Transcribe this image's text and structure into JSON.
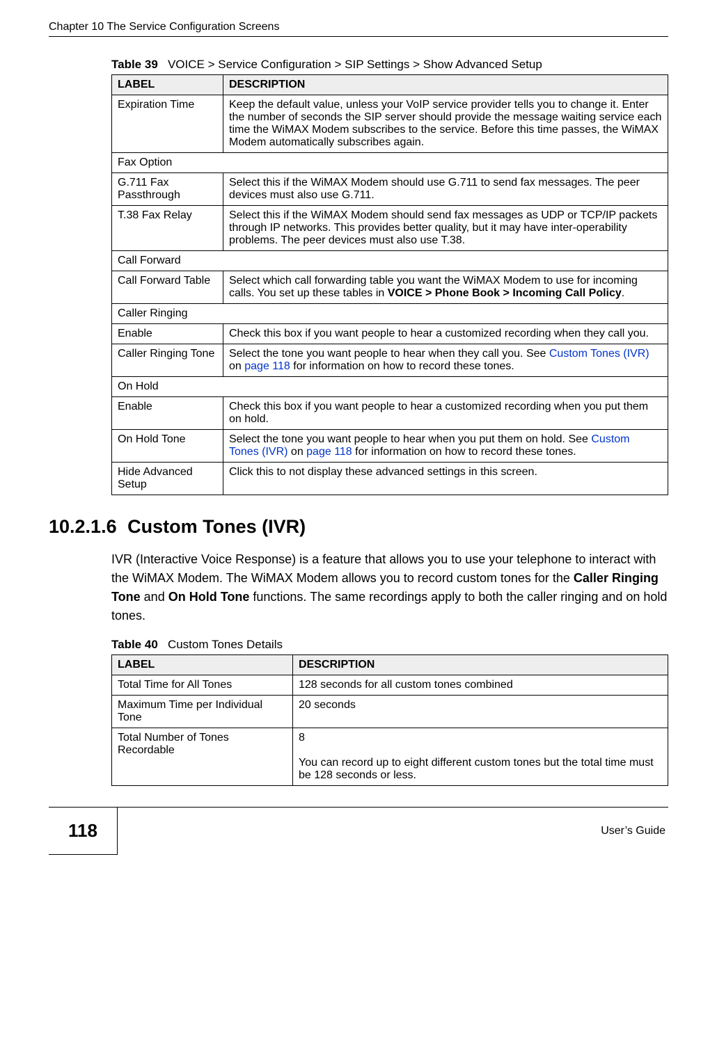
{
  "running_header": "Chapter 10 The Service Configuration Screens",
  "table39": {
    "caption_label": "Table 39",
    "caption_text": "VOICE > Service Configuration > SIP Settings > Show Advanced Setup",
    "headers": {
      "label": "LABEL",
      "description": "DESCRIPTION"
    },
    "rows": {
      "expiration_time": {
        "label": "Expiration Time",
        "desc": "Keep the default value, unless your VoIP service provider tells you to change it. Enter the number of seconds the SIP server should provide the message waiting service each time the WiMAX Modem subscribes to the service. Before this time passes, the WiMAX Modem automatically subscribes again."
      },
      "fax_option": {
        "label": "Fax Option"
      },
      "g711": {
        "label": "G.711 Fax Passthrough",
        "desc": "Select this if the WiMAX Modem should use G.711 to send fax messages. The peer devices must also use G.711."
      },
      "t38": {
        "label": "T.38 Fax Relay",
        "desc": "Select this if the WiMAX Modem should send fax messages as UDP or TCP/IP packets through IP networks. This provides better quality, but it may have inter-operability problems. The peer devices must also use T.38."
      },
      "call_forward": {
        "label": "Call Forward"
      },
      "call_forward_table": {
        "label": "Call Forward Table",
        "desc_pre": "Select which call forwarding table you want the WiMAX Modem to use for incoming calls. You set up these tables in ",
        "desc_bold": "VOICE > Phone Book > Incoming Call Policy",
        "desc_post": "."
      },
      "caller_ringing": {
        "label": "Caller Ringing"
      },
      "enable1": {
        "label": "Enable",
        "desc": "Check this box if you want people to hear a customized recording when they call you."
      },
      "caller_ringing_tone": {
        "label": "Caller Ringing Tone",
        "desc_pre": "Select the tone you want people to hear when they call you. See ",
        "link": "Custom Tones (IVR)",
        "desc_mid": " on ",
        "link2": "page 118",
        "desc_post": " for information on how to record these tones."
      },
      "on_hold": {
        "label": "On Hold"
      },
      "enable2": {
        "label": "Enable",
        "desc": "Check this box if you want people to hear a customized recording when you put them on hold."
      },
      "on_hold_tone": {
        "label": "On Hold Tone",
        "desc_pre": "Select the tone you want people to hear when you put them on hold. See ",
        "link": "Custom Tones (IVR)",
        "desc_mid": " on ",
        "link2": "page 118",
        "desc_post": " for information on how to record these tones."
      },
      "hide_advanced": {
        "label": "Hide Advanced Setup",
        "desc": "Click this to not display these advanced settings in this screen."
      }
    }
  },
  "section": {
    "number": "10.2.1.6",
    "title": "Custom Tones (IVR)",
    "para_pre": "IVR (Interactive Voice Response) is a feature that allows you to use your telephone to interact with the WiMAX Modem. The WiMAX Modem allows you to record custom tones for the ",
    "bold1": "Caller Ringing Tone",
    "para_mid": " and ",
    "bold2": "On Hold Tone",
    "para_post": " functions. The same recordings apply to both the caller ringing and on hold tones."
  },
  "table40": {
    "caption_label": "Table 40",
    "caption_text": "Custom Tones Details",
    "headers": {
      "label": "LABEL",
      "description": "DESCRIPTION"
    },
    "rows": {
      "total_time": {
        "label": "Total Time for All Tones",
        "desc": "128 seconds for all custom tones combined"
      },
      "max_time": {
        "label": "Maximum Time per Individual Tone",
        "desc": "20 seconds"
      },
      "total_number": {
        "label": "Total Number of Tones Recordable",
        "desc_first": "8",
        "desc_second": "You can record up to eight different custom tones but the total time must be 128 seconds or less."
      }
    }
  },
  "footer": {
    "page_number": "118",
    "guide": "User’s Guide"
  }
}
